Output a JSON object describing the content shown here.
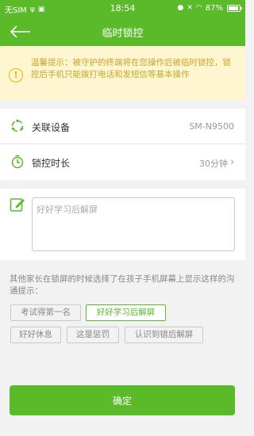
{
  "status_bar": {
    "carrier": "无SIM",
    "time": "18:54",
    "battery": "87%"
  },
  "header": {
    "title": "临时锁控",
    "back_icon": "back-arrow-icon"
  },
  "notice": {
    "icon": "exclamation-icon",
    "text": "温馨提示：被守护的终端将在您操作后被临时锁控，锁控后手机只能拨打电话和发短信等基本操作"
  },
  "settings": {
    "device": {
      "label": "关联设备",
      "value": "SM-N9500",
      "icon": "sync-icon"
    },
    "duration": {
      "label": "锁控时长",
      "value": "30分钟",
      "icon": "timer-icon",
      "chevron": "›"
    }
  },
  "message": {
    "placeholder": "好好学习后解屏",
    "icon": "edit-icon"
  },
  "hint": "其他家长在锁屏的时候选择了在孩子手机屏幕上显示这样的沟通提示：",
  "tags": [
    {
      "label": "考试得第一名",
      "selected": false
    },
    {
      "label": "好好学习后解屏",
      "selected": true
    },
    {
      "label": "好好休息",
      "selected": false
    },
    {
      "label": "这是惩罚",
      "selected": false
    },
    {
      "label": "认识到错后解屏",
      "selected": false
    }
  ],
  "confirm_label": "确定",
  "colors": {
    "primary": "#5bba2a",
    "notice_bg": "#fdf6d0",
    "notice_text": "#c9a52d",
    "notice_icon": "#f0b400"
  }
}
